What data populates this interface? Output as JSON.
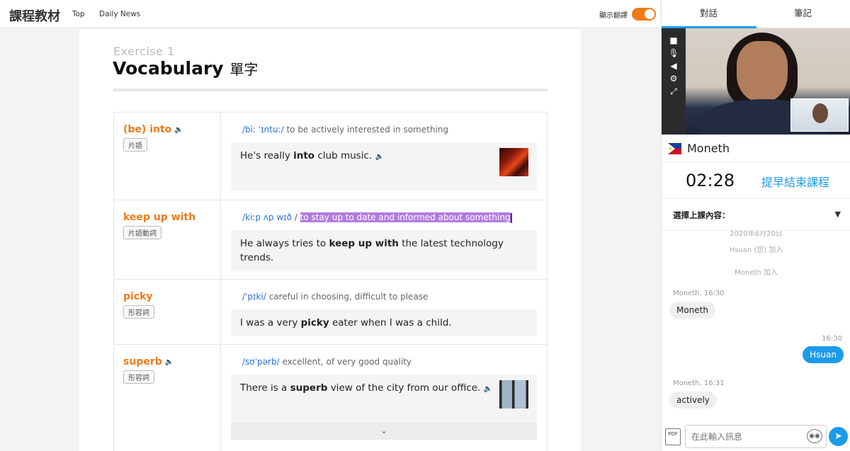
{
  "header": {
    "brand": "課程教材",
    "nav": [
      "Top",
      "Daily News"
    ],
    "translate_label": "顯示翻譯",
    "translate_on": true,
    "accent": "#f07b1a"
  },
  "exercise": {
    "label": "Exercise 1",
    "title": "Vocabulary",
    "title_zh": "單字"
  },
  "vocab": [
    {
      "word": "(be) into",
      "pos": "片語",
      "pron": "/biː ˈɪntuː/",
      "definition": "to be actively interested in something",
      "ex_pre": "He's really ",
      "ex_bold": "into",
      "ex_post": " club music.",
      "image": "fire-image"
    },
    {
      "word": "keep up with",
      "pos": "片語動詞",
      "pron": "/kiːp ʌp wɪð",
      "definition": "to stay up to date and informed about something",
      "ex_pre": "He always tries to ",
      "ex_bold": "keep up with",
      "ex_post": " the latest technology trends."
    },
    {
      "word": "picky",
      "pos": "形容詞",
      "pron": "/ˈpɪki/",
      "definition": "careful in choosing, difficult to please",
      "ex_pre": "I was a very ",
      "ex_bold": "picky",
      "ex_post": " eater when I was a child."
    },
    {
      "word": "superb",
      "pos": "形容詞",
      "pron": "/sʊˈpərb/",
      "definition": "excellent, of very good quality",
      "ex_pre": "There is a ",
      "ex_bold": "superb",
      "ex_post": " view of the city from our office.",
      "image": "city-image"
    }
  ],
  "sidebar": {
    "tabs": [
      "對話",
      "筆記"
    ],
    "active_tab": 0,
    "tutor": {
      "name": "Moneth",
      "flag": "philippines-flag-icon"
    },
    "timer": "02:28",
    "end_label": "提早結束課程",
    "select_label": "選擇上課內容：",
    "chat": {
      "date": "2020年6月20日",
      "system": [
        "Hsuan (您) 加入",
        "Moneth 加入"
      ],
      "messages": [
        {
          "from": "Moneth",
          "time": "Moneth, 16:30",
          "text": "Moneth",
          "dir": "in"
        },
        {
          "from": "Hsuan",
          "time": "16:30",
          "text": "Hsuan",
          "dir": "out"
        },
        {
          "from": "Moneth",
          "time": "Moneth, 16:31",
          "text": "actively",
          "dir": "in"
        }
      ]
    },
    "input_placeholder": "在此輸入訊息",
    "accent": "#1c9be8"
  }
}
